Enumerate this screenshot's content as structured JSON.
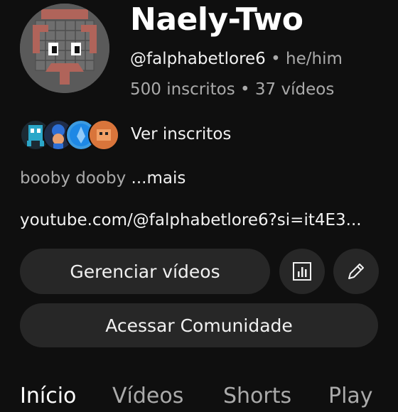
{
  "channel": {
    "name": "Naely-Two",
    "handle": "@falphabetlore6",
    "pronouns": "• he/him",
    "stats": "500 inscritos • 37 vídeos"
  },
  "subscribers": {
    "link_label": "Ver inscritos"
  },
  "description": {
    "text": "booby dooby",
    "more_label": "...mais"
  },
  "link": {
    "text": "youtube.com/@falphabetlore6?si=it4E3..."
  },
  "buttons": {
    "manage_videos": "Gerenciar vídeos",
    "analytics_icon": "bar-chart-icon",
    "edit_icon": "pencil-icon",
    "community": "Acessar Comunidade"
  },
  "tabs": [
    {
      "label": "Início"
    },
    {
      "label": "Vídeos"
    },
    {
      "label": "Shorts"
    },
    {
      "label": "Play"
    }
  ],
  "colors": {
    "background": "#0f0f0f",
    "button_bg": "#272727",
    "text_primary": "#f1f1f1",
    "text_secondary": "#aaaaaa"
  }
}
